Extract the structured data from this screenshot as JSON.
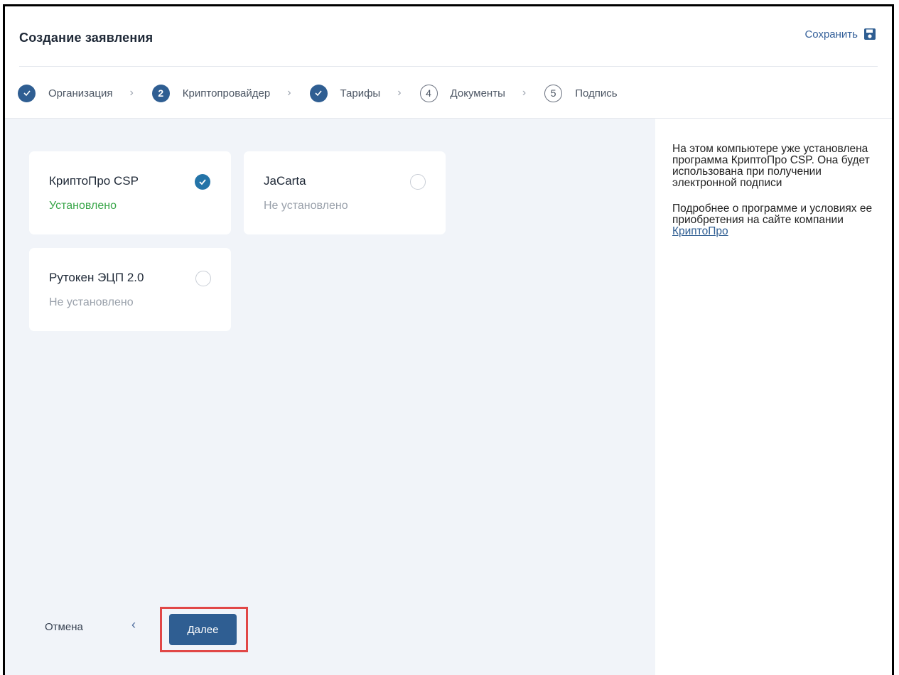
{
  "header": {
    "title": "Создание заявления",
    "save_label": "Сохранить"
  },
  "stepper": {
    "steps": [
      {
        "label": "Организация",
        "state": "done",
        "marker": "✓"
      },
      {
        "label": "Криптопровайдер",
        "state": "current",
        "marker": "2"
      },
      {
        "label": "Тарифы",
        "state": "done",
        "marker": "✓"
      },
      {
        "label": "Документы",
        "state": "todo",
        "marker": "4"
      },
      {
        "label": "Подпись",
        "state": "todo",
        "marker": "5"
      }
    ],
    "separator": "›"
  },
  "providers": [
    {
      "name": "КриптоПро CSP",
      "status": "Установлено",
      "installed": true,
      "selected": true
    },
    {
      "name": "JaCarta",
      "status": "Не установлено",
      "installed": false,
      "selected": false
    },
    {
      "name": "Рутокен ЭЦП 2.0",
      "status": "Не установлено",
      "installed": false,
      "selected": false
    }
  ],
  "info": {
    "paragraph1": "На этом компьютере уже установлена программа КриптоПро CSP. Она будет использована при получении электронной подписи",
    "paragraph2_prefix": "Подробнее о программе и условиях ее приобретения на сайте компании ",
    "link_label": "КриптоПро"
  },
  "footer": {
    "cancel_label": "Отмена",
    "back_label": "‹",
    "next_label": "Далее"
  },
  "colors": {
    "accent": "#2f5e92",
    "check": "#2474a8",
    "installed": "#3aa64a",
    "not_installed": "#9aa1ab",
    "highlight": "#e14747"
  },
  "icons": [
    "save-icon",
    "check-icon",
    "chevron-right-icon",
    "chevron-left-icon"
  ]
}
